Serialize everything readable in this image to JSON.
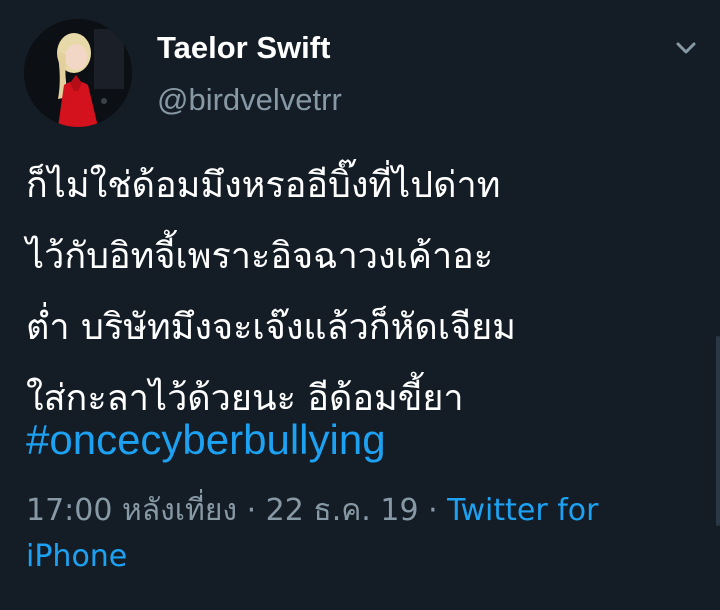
{
  "user": {
    "display_name": "Taelor Swift",
    "handle": "@birdvelvetrr",
    "avatar_icon": "profile-photo"
  },
  "tweet": {
    "text": "ก็ไม่ใช่ด้อมมึงหรออีบิ๊งที่ไปด่าท\nไว้กับอิทจี้เพราะอิจฉาวงเค้าอะ\nต่ำ บริษัทมึงจะเจ๊งแล้วก็หัดเจียม\nใส่กะลาไว้ด้วยนะ อีด้อมขี้ยา",
    "hashtag": "#oncecyberbullying",
    "time": "17:00 หลังเที่ยง",
    "separator": " · ",
    "date": "22 ธ.ค. 19",
    "source": "Twitter for iPhone"
  },
  "icons": {
    "menu": "chevron-down-icon"
  },
  "colors": {
    "background": "#141d26",
    "text": "#ffffff",
    "secondary": "#8899a6",
    "link": "#1da1f2"
  }
}
